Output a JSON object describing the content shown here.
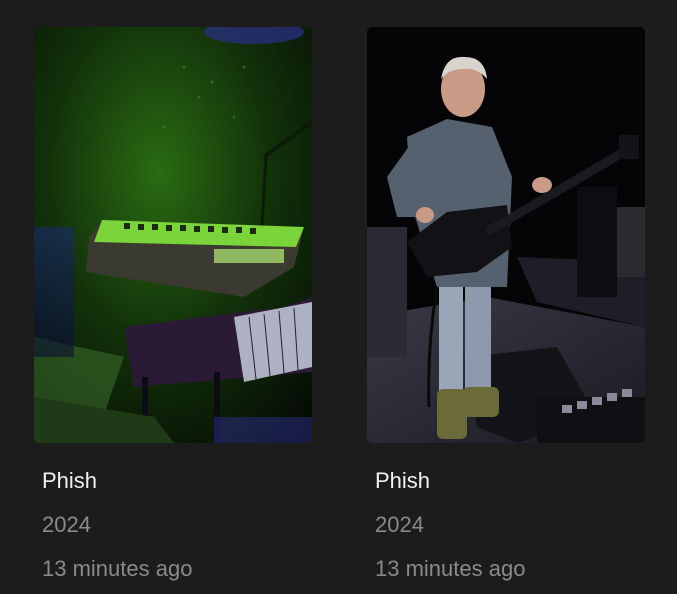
{
  "items": [
    {
      "title": "Phish",
      "year": "2024",
      "added": "13 minutes ago",
      "poster_icon": "keyboard-stage-photo"
    },
    {
      "title": "Phish",
      "year": "2024",
      "added": "13 minutes ago",
      "poster_icon": "bassist-stage-photo"
    }
  ],
  "colors": {
    "background": "#1c1c1c",
    "title": "#f2f2f2",
    "secondary": "#8a8a8a"
  }
}
